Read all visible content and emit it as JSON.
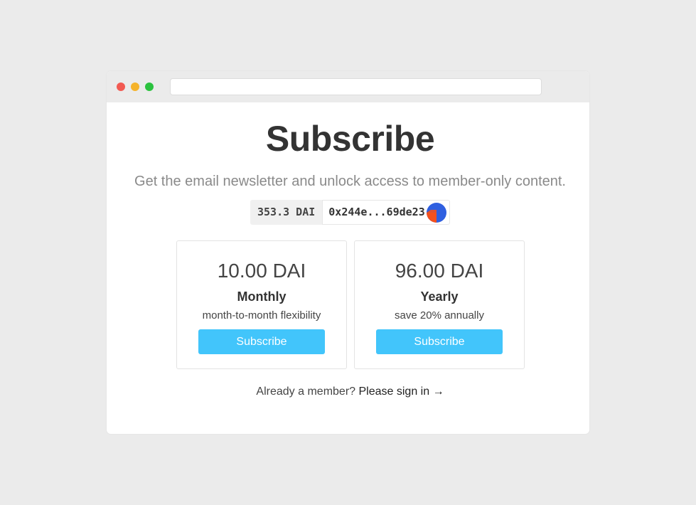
{
  "browser": {
    "traffic_lights": {
      "close_color": "#f25a52",
      "minimize_color": "#f5b32b",
      "maximize_color": "#2bc23f"
    },
    "url": ""
  },
  "page": {
    "title": "Subscribe",
    "subtitle": "Get the email newsletter and unlock access to member-only content."
  },
  "wallet": {
    "balance": "353.3 DAI",
    "address": "0x244e...69de23",
    "identicon_colors": [
      "#2f5fe0",
      "#f4511e"
    ]
  },
  "plans": [
    {
      "price": "10.00 DAI",
      "name": "Monthly",
      "description": "month-to-month flexibility",
      "button_label": "Subscribe"
    },
    {
      "price": "96.00 DAI",
      "name": "Yearly",
      "description": "save 20% annually",
      "button_label": "Subscribe"
    }
  ],
  "signin": {
    "prompt": "Already a member?",
    "link_label": "Please sign in →"
  },
  "colors": {
    "accent": "#42c5fb",
    "background": "#ebebeb"
  }
}
